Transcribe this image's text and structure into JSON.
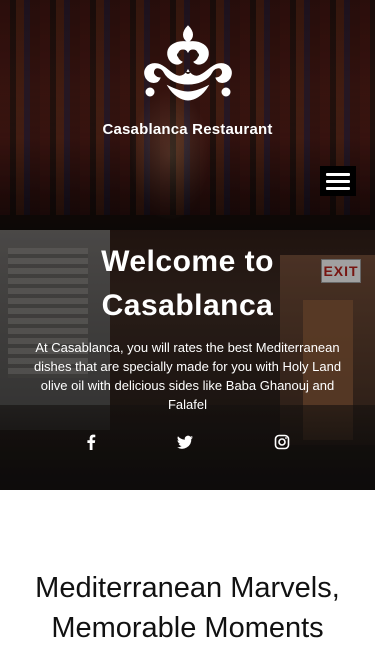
{
  "header": {
    "brand_name": "Casablanca Restaurant",
    "menu_icon": "hamburger-menu-icon",
    "logo_icon": "ornamental-logo-icon"
  },
  "hero": {
    "heading_line1": "Welcome to",
    "heading_line2": "Casablanca",
    "intro": "At Casablanca, you  will rates the best Mediterranean dishes that are specially made for you with Holy Land olive oil with delicious sides like Baba Ghanouj and Falafel",
    "exit_sign": "EXIT"
  },
  "social": [
    {
      "name": "facebook",
      "icon": "facebook-icon"
    },
    {
      "name": "twitter",
      "icon": "twitter-icon"
    },
    {
      "name": "instagram",
      "icon": "instagram-icon"
    }
  ],
  "section2": {
    "heading": "Mediterranean Marvels, Memorable Moments"
  },
  "colors": {
    "text": "#ffffff",
    "menu_bg": "#000000",
    "section_bg": "#ffffff",
    "heading_dark": "#111111"
  }
}
